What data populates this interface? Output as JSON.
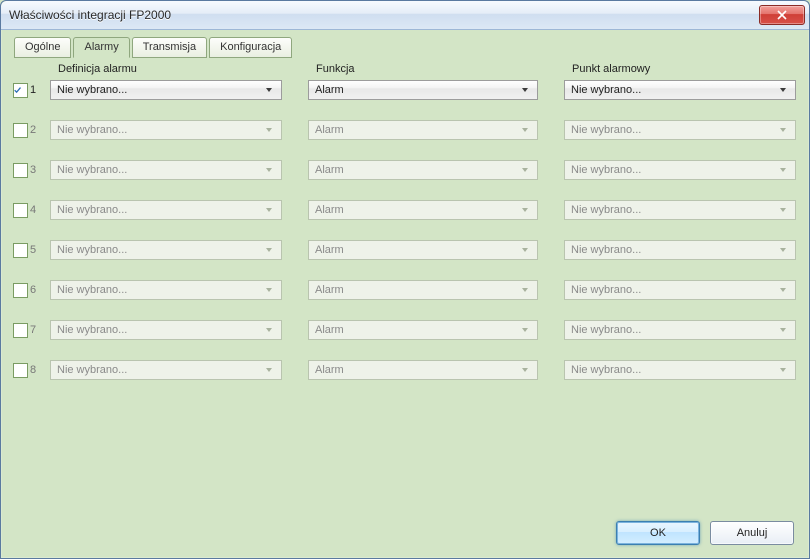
{
  "window": {
    "title": "Właściwości integracji FP2000"
  },
  "tabs": [
    {
      "label": "Ogólne",
      "active": false
    },
    {
      "label": "Alarmy",
      "active": true
    },
    {
      "label": "Transmisja",
      "active": false
    },
    {
      "label": "Konfiguracja",
      "active": false
    }
  ],
  "headers": {
    "definition": "Definicja alarmu",
    "function": "Funkcja",
    "point": "Punkt alarmowy"
  },
  "rows": [
    {
      "idx": "1",
      "checked": true,
      "enabled": true,
      "definition": "Nie wybrano...",
      "function": "Alarm",
      "point": "Nie wybrano..."
    },
    {
      "idx": "2",
      "checked": false,
      "enabled": false,
      "definition": "Nie wybrano...",
      "function": "Alarm",
      "point": "Nie wybrano..."
    },
    {
      "idx": "3",
      "checked": false,
      "enabled": false,
      "definition": "Nie wybrano...",
      "function": "Alarm",
      "point": "Nie wybrano..."
    },
    {
      "idx": "4",
      "checked": false,
      "enabled": false,
      "definition": "Nie wybrano...",
      "function": "Alarm",
      "point": "Nie wybrano..."
    },
    {
      "idx": "5",
      "checked": false,
      "enabled": false,
      "definition": "Nie wybrano...",
      "function": "Alarm",
      "point": "Nie wybrano..."
    },
    {
      "idx": "6",
      "checked": false,
      "enabled": false,
      "definition": "Nie wybrano...",
      "function": "Alarm",
      "point": "Nie wybrano..."
    },
    {
      "idx": "7",
      "checked": false,
      "enabled": false,
      "definition": "Nie wybrano...",
      "function": "Alarm",
      "point": "Nie wybrano..."
    },
    {
      "idx": "8",
      "checked": false,
      "enabled": false,
      "definition": "Nie wybrano...",
      "function": "Alarm",
      "point": "Nie wybrano..."
    }
  ],
  "buttons": {
    "ok": "OK",
    "cancel": "Anuluj"
  }
}
